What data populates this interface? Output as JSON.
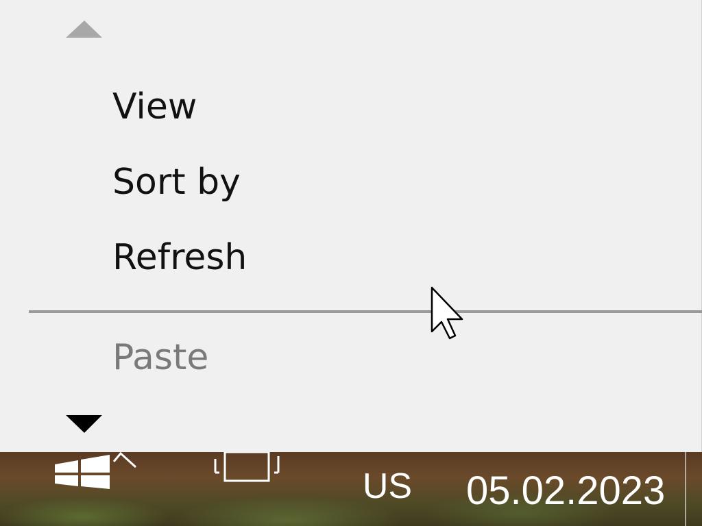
{
  "context_menu": {
    "items": [
      {
        "label": "View",
        "enabled": true
      },
      {
        "label": "Sort by",
        "enabled": true
      },
      {
        "label": "Refresh",
        "enabled": true
      },
      {
        "label": "Paste",
        "enabled": false
      }
    ],
    "scroll_up_icon": "triangle-up-icon",
    "scroll_down_icon": "triangle-down-icon",
    "background_color": "#f0f0f0",
    "disabled_text_color": "#7a7a7a"
  },
  "taskbar": {
    "start_icon": "windows-logo-icon",
    "tray_icon": "chevron-up-icon",
    "task_view_icon": "task-view-icon",
    "language": "US",
    "date": "05.02.2023"
  },
  "cursor_icon": "arrow-pointer-icon"
}
